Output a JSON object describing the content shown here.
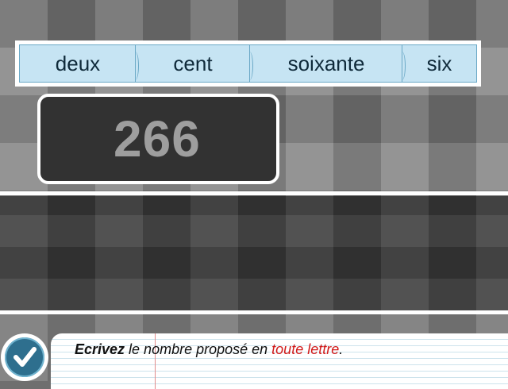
{
  "words": [
    "deux",
    "cent",
    "soixante",
    "six"
  ],
  "number": "266",
  "instruction": {
    "verb": "Ecrivez",
    "middle": " le nombre proposé en ",
    "highlight": "toute lettre",
    "end": "."
  },
  "icons": {
    "validate": "check-icon"
  },
  "colors": {
    "word_bg": "#c6e4f3",
    "number_box": "#323232",
    "highlight": "#d11a1a",
    "button": "#2e6f8e"
  }
}
